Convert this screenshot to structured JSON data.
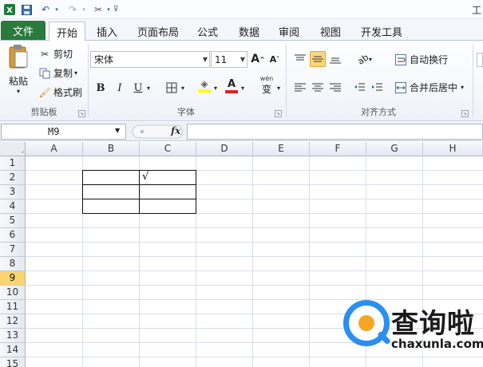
{
  "qat": {
    "title_fragment": "工",
    "icons": [
      "save-icon",
      "undo-icon",
      "redo-icon",
      "tools-icon",
      "customize-icon"
    ]
  },
  "tabs": {
    "file": "文件",
    "items": [
      "开始",
      "插入",
      "页面布局",
      "公式",
      "数据",
      "审阅",
      "视图",
      "开发工具"
    ],
    "active": "开始"
  },
  "clipboard": {
    "paste": "粘贴",
    "cut": "剪切",
    "copy": "复制",
    "format_painter": "格式刷",
    "label": "剪贴板"
  },
  "font": {
    "name": "宋体",
    "size": "11",
    "bold": "B",
    "italic": "I",
    "underline": "U",
    "label": "字体",
    "wen": "wén"
  },
  "alignment": {
    "wrap_text": "自动换行",
    "merge_center": "合并后居中",
    "label": "对齐方式"
  },
  "formula_bar": {
    "name_box": "M9",
    "fx": "fx",
    "value": ""
  },
  "sheet": {
    "columns": [
      "A",
      "B",
      "C",
      "D",
      "E",
      "F",
      "G",
      "H"
    ],
    "rows": [
      "1",
      "2",
      "3",
      "4",
      "5",
      "6",
      "7",
      "8",
      "9",
      "10",
      "11",
      "12",
      "13",
      "14",
      "15"
    ],
    "selected_row": "9",
    "cells": {
      "C2": "√"
    }
  },
  "watermark": {
    "name": "查询啦",
    "url": "chaxunla.com"
  },
  "colors": {
    "file_tab": "#2a7a3b",
    "selection": "#f9d46f",
    "accent_blue": "#2a8ff0",
    "accent_orange": "#f5a623"
  }
}
